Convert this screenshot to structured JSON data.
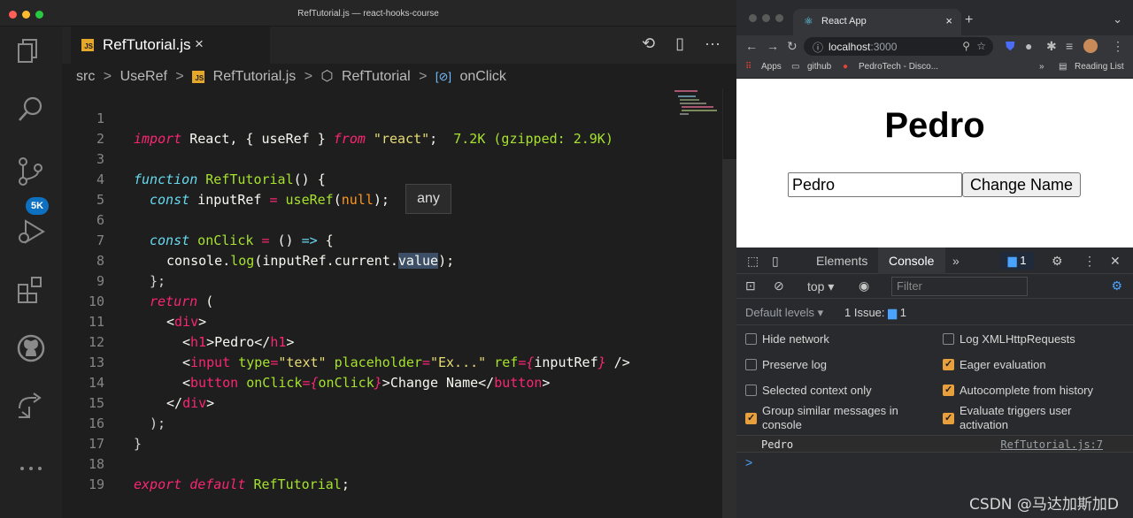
{
  "vscode": {
    "window_title": "RefTutorial.js — react-hooks-course",
    "tab": {
      "label": "RefTutorial.js",
      "close": "×",
      "file_badge": "JS"
    },
    "tab_actions": [
      "⟲",
      "▯",
      "···"
    ],
    "source_control_badge": "5K",
    "breadcrumb": {
      "folder": "src",
      "sub": "UseRef",
      "file": "RefTutorial.js",
      "component": "RefTutorial",
      "symbol": "onClick",
      "separator": ">"
    },
    "hover_tooltip": "any",
    "line_numbers": [
      "1",
      "2",
      "3",
      "4",
      "5",
      "6",
      "7",
      "8",
      "9",
      "10",
      "11",
      "12",
      "13",
      "14",
      "15",
      "16",
      "17",
      "18",
      "19"
    ],
    "code": {
      "l1": {
        "import": "import",
        "react": " React, { useRef } ",
        "from": "from",
        "str": " \"react\"",
        "semi": ";",
        "hint": "  7.2K (gzipped: 2.9K)"
      },
      "l3": {
        "kw": "function",
        "name": " RefTutorial",
        "rest": "() {"
      },
      "l4": {
        "kw": "const",
        "a": " inputRef ",
        "eq": "=",
        "fn": " useRef",
        "b": "(",
        "null": "null",
        "c": ");"
      },
      "l6": {
        "kw": "const",
        "name": " onClick ",
        "eq": "=",
        "a": " () ",
        "arrow": "=>",
        "b": " {"
      },
      "l7": {
        "a": "console.",
        "fn": "log",
        "b": "(inputRef.current.",
        "sel": "value",
        "c": ");"
      },
      "l8": {
        "a": "};"
      },
      "l9": {
        "kw": "return",
        "a": " ("
      },
      "l10": {
        "lt": "<",
        "tag": "div",
        "gt": ">"
      },
      "l11": {
        "lt": "<",
        "tag": "h1",
        "gt": ">",
        "text": "Pedro",
        "lt2": "</",
        "tag2": "h1",
        "gt2": ">"
      },
      "l12": {
        "lt": "<",
        "tag": "input",
        "attr1": " type",
        "eq1": "=",
        "val1": "\"text\"",
        "attr2": " placeholder",
        "eq2": "=",
        "val2": "\"Ex...\"",
        "attr3": " ref",
        "eq3": "={",
        "val3": "inputRef",
        "close3": "}",
        "end": " />"
      },
      "l13": {
        "lt": "<",
        "tag": "button",
        "attr": " onClick",
        "eq": "={",
        "val": "onClick",
        "close": "}",
        "gt": ">",
        "text": "Change Name",
        "lt2": "</",
        "tag2": "button",
        "gt2": ">"
      },
      "l14": {
        "lt": "</",
        "tag": "div",
        "gt": ">"
      },
      "l15": {
        "a": ");"
      },
      "l16": {
        "a": "}"
      },
      "l18": {
        "kw1": "export",
        "kw2": " default",
        "name": " RefTutorial",
        "semi": ";"
      }
    }
  },
  "browser": {
    "tab_title": "React App",
    "tab_close": "×",
    "new_tab": "+",
    "url_host": "localhost",
    "url_port": ":3000",
    "bookmarks": {
      "apps": "Apps",
      "github": "github",
      "pedrotech": "PedroTech - Disco...",
      "more": "»",
      "reading_list": "Reading List"
    },
    "page": {
      "heading": "Pedro",
      "input_value": "Pedro",
      "button_label": "Change Name"
    },
    "devtools": {
      "tabs": {
        "elements": "Elements",
        "console": "Console",
        "more": "»"
      },
      "message_count": "1",
      "context": "top ▾",
      "filter_placeholder": "Filter",
      "default_levels": "Default levels ▾",
      "issues": "1 Issue:",
      "issues_count": "1",
      "options": {
        "hide_network": "Hide network",
        "preserve_log": "Preserve log",
        "selected_context": "Selected context only",
        "group_similar": "Group similar messages in console",
        "log_xhr": "Log XMLHttpRequests",
        "eager_eval": "Eager evaluation",
        "autocomplete": "Autocomplete from history",
        "evaluate_triggers": "Evaluate triggers user activation"
      },
      "log_message": "Pedro",
      "log_source": "RefTutorial.js:7",
      "prompt": ">"
    }
  },
  "watermark": "CSDN @马达加斯加D",
  "colors": {
    "keyword": "#f92672",
    "storage": "#66d9ef",
    "string": "#e6db74",
    "function": "#a6e22e",
    "null": "#fd971f",
    "checkbox_on": "#e8a03c",
    "badge_blue": "#0e70c0"
  }
}
